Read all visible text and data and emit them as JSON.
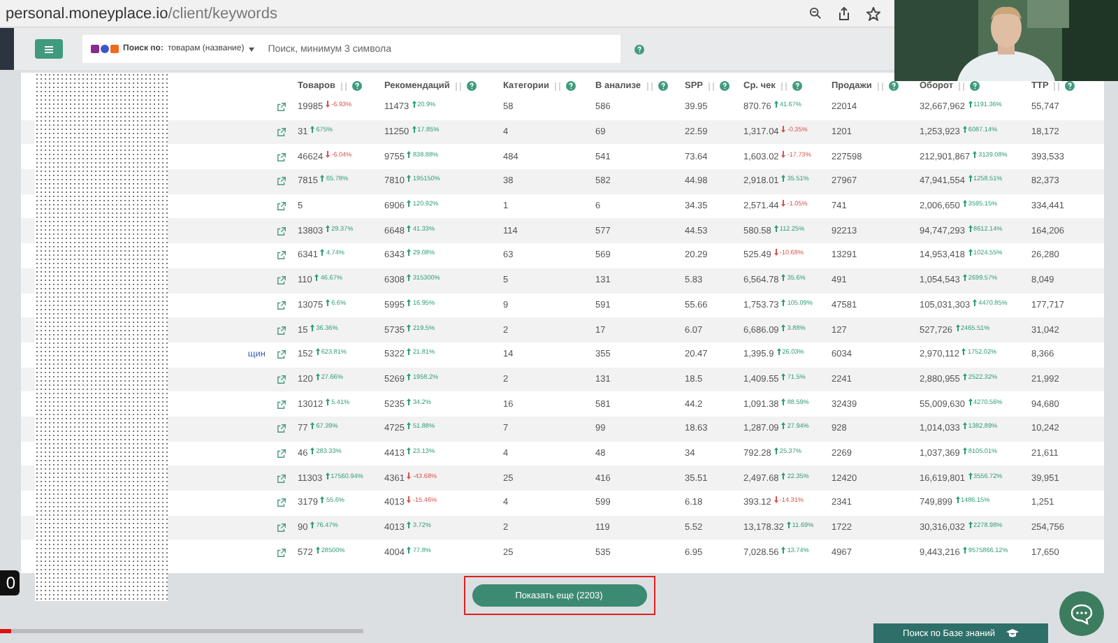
{
  "browser": {
    "url_host": "personal.moneyplace.io",
    "url_path": "/client/keywords"
  },
  "toolbar": {
    "search_by_label": "Поиск по:",
    "search_by_value": "товарам (название)",
    "search_placeholder": "Поиск, минимум 3 символа"
  },
  "table": {
    "columns": [
      "Товаров",
      "Рекомендаций",
      "Категории",
      "В анализе",
      "SPP",
      "Ср. чек",
      "Продажи",
      "Оборот",
      "TTP"
    ],
    "rows": [
      {
        "cells": [
          {
            "value": "19985",
            "change": "-6.93%",
            "rising": false
          },
          {
            "value": "11473",
            "change": "20.9%",
            "rising": true
          },
          {
            "value": "58"
          },
          {
            "value": "586"
          },
          {
            "value": "39.95"
          },
          {
            "value": "870.76",
            "change": "41.67%",
            "rising": true
          },
          {
            "value": "22014"
          },
          {
            "value": "32,667,962",
            "change": "1191.36%",
            "rising": true
          },
          {
            "value": "55,747"
          }
        ]
      },
      {
        "cells": [
          {
            "value": "31",
            "change": "675%",
            "rising": true
          },
          {
            "value": "11250",
            "change": "17.85%",
            "rising": true
          },
          {
            "value": "4"
          },
          {
            "value": "69"
          },
          {
            "value": "22.59"
          },
          {
            "value": "1,317.04",
            "change": "-0.35%",
            "rising": false
          },
          {
            "value": "1201"
          },
          {
            "value": "1,253,923",
            "change": "6087.14%",
            "rising": true
          },
          {
            "value": "18,172"
          }
        ]
      },
      {
        "cells": [
          {
            "value": "46624",
            "change": "-6.04%",
            "rising": false
          },
          {
            "value": "9755",
            "change": "838.88%",
            "rising": true
          },
          {
            "value": "484"
          },
          {
            "value": "541"
          },
          {
            "value": "73.64"
          },
          {
            "value": "1,603.02",
            "change": "-17.73%",
            "rising": false
          },
          {
            "value": "227598"
          },
          {
            "value": "212,901,867",
            "change": "3139.08%",
            "rising": true
          },
          {
            "value": "393,533"
          }
        ]
      },
      {
        "cells": [
          {
            "value": "7815",
            "change": "65.78%",
            "rising": true
          },
          {
            "value": "7810",
            "change": "195150%",
            "rising": true
          },
          {
            "value": "38"
          },
          {
            "value": "582"
          },
          {
            "value": "44.98"
          },
          {
            "value": "2,918.01",
            "change": "35.51%",
            "rising": true
          },
          {
            "value": "27967"
          },
          {
            "value": "47,941,554",
            "change": "1258.51%",
            "rising": true
          },
          {
            "value": "82,373"
          }
        ]
      },
      {
        "cells": [
          {
            "value": "5"
          },
          {
            "value": "6906",
            "change": "120.92%",
            "rising": true
          },
          {
            "value": "1"
          },
          {
            "value": "6"
          },
          {
            "value": "34.35"
          },
          {
            "value": "2,571.44",
            "change": "-1.05%",
            "rising": false
          },
          {
            "value": "741"
          },
          {
            "value": "2,006,650",
            "change": "3595.15%",
            "rising": true
          },
          {
            "value": "334,441"
          }
        ]
      },
      {
        "cells": [
          {
            "value": "13803",
            "change": "29.37%",
            "rising": true
          },
          {
            "value": "6648",
            "change": "41.33%",
            "rising": true
          },
          {
            "value": "114"
          },
          {
            "value": "577"
          },
          {
            "value": "44.53"
          },
          {
            "value": "580.58",
            "change": "112.25%",
            "rising": true
          },
          {
            "value": "92213"
          },
          {
            "value": "94,747,293",
            "change": "8612.14%",
            "rising": true
          },
          {
            "value": "164,206"
          }
        ]
      },
      {
        "cells": [
          {
            "value": "6341",
            "change": "4.74%",
            "rising": true
          },
          {
            "value": "6343",
            "change": "29.08%",
            "rising": true
          },
          {
            "value": "63"
          },
          {
            "value": "569"
          },
          {
            "value": "20.29"
          },
          {
            "value": "525.49",
            "change": "-10.68%",
            "rising": false
          },
          {
            "value": "13291"
          },
          {
            "value": "14,953,418",
            "change": "1024.55%",
            "rising": true
          },
          {
            "value": "26,280"
          }
        ]
      },
      {
        "cells": [
          {
            "value": "110",
            "change": "46.67%",
            "rising": true
          },
          {
            "value": "6308",
            "change": "315300%",
            "rising": true
          },
          {
            "value": "5"
          },
          {
            "value": "131"
          },
          {
            "value": "5.83"
          },
          {
            "value": "6,564.78",
            "change": "35.6%",
            "rising": true
          },
          {
            "value": "491"
          },
          {
            "value": "1,054,543",
            "change": "2699.57%",
            "rising": true
          },
          {
            "value": "8,049"
          }
        ]
      },
      {
        "cells": [
          {
            "value": "13075",
            "change": "6.6%",
            "rising": true
          },
          {
            "value": "5995",
            "change": "16.95%",
            "rising": true
          },
          {
            "value": "9"
          },
          {
            "value": "591"
          },
          {
            "value": "55.66"
          },
          {
            "value": "1,753.73",
            "change": "105.09%",
            "rising": true
          },
          {
            "value": "47581"
          },
          {
            "value": "105,031,303",
            "change": "4470.85%",
            "rising": true
          },
          {
            "value": "177,717"
          }
        ]
      },
      {
        "cells": [
          {
            "value": "15",
            "change": "36.36%",
            "rising": true
          },
          {
            "value": "5735",
            "change": "219.5%",
            "rising": true
          },
          {
            "value": "2"
          },
          {
            "value": "17"
          },
          {
            "value": "6.07"
          },
          {
            "value": "6,686.09",
            "change": "3.88%",
            "rising": true
          },
          {
            "value": "127"
          },
          {
            "value": "527,726",
            "change": "2465.51%",
            "rising": true
          },
          {
            "value": "31,042"
          }
        ]
      },
      {
        "name": "щин",
        "cells": [
          {
            "value": "152",
            "change": "623.81%",
            "rising": true
          },
          {
            "value": "5322",
            "change": "21.81%",
            "rising": true
          },
          {
            "value": "14"
          },
          {
            "value": "355"
          },
          {
            "value": "20.47"
          },
          {
            "value": "1,395.9",
            "change": "26.03%",
            "rising": true
          },
          {
            "value": "6034"
          },
          {
            "value": "2,970,112",
            "change": "1752.02%",
            "rising": true
          },
          {
            "value": "8,366"
          }
        ]
      },
      {
        "cells": [
          {
            "value": "120",
            "change": "27.66%",
            "rising": true
          },
          {
            "value": "5269",
            "change": "1958.2%",
            "rising": true
          },
          {
            "value": "2"
          },
          {
            "value": "131"
          },
          {
            "value": "18.5"
          },
          {
            "value": "1,409.55",
            "change": "71.5%",
            "rising": true
          },
          {
            "value": "2241"
          },
          {
            "value": "2,880,955",
            "change": "2522.32%",
            "rising": true
          },
          {
            "value": "21,992"
          }
        ]
      },
      {
        "cells": [
          {
            "value": "13012",
            "change": "5.41%",
            "rising": true
          },
          {
            "value": "5235",
            "change": "34.2%",
            "rising": true
          },
          {
            "value": "16"
          },
          {
            "value": "581"
          },
          {
            "value": "44.2"
          },
          {
            "value": "1,091.38",
            "change": "88.59%",
            "rising": true
          },
          {
            "value": "32439"
          },
          {
            "value": "55,009,630",
            "change": "4270.56%",
            "rising": true
          },
          {
            "value": "94,680"
          }
        ]
      },
      {
        "cells": [
          {
            "value": "77",
            "change": "67.39%",
            "rising": true
          },
          {
            "value": "4725",
            "change": "51.88%",
            "rising": true
          },
          {
            "value": "7"
          },
          {
            "value": "99"
          },
          {
            "value": "18.63"
          },
          {
            "value": "1,287.09",
            "change": "27.94%",
            "rising": true
          },
          {
            "value": "928"
          },
          {
            "value": "1,014,033",
            "change": "1382.89%",
            "rising": true
          },
          {
            "value": "10,242"
          }
        ]
      },
      {
        "cells": [
          {
            "value": "46",
            "change": "283.33%",
            "rising": true
          },
          {
            "value": "4413",
            "change": "23.13%",
            "rising": true
          },
          {
            "value": "4"
          },
          {
            "value": "48"
          },
          {
            "value": "34"
          },
          {
            "value": "792.28",
            "change": "25.37%",
            "rising": true
          },
          {
            "value": "2269"
          },
          {
            "value": "1,037,369",
            "change": "8105.01%",
            "rising": true
          },
          {
            "value": "21,611"
          }
        ]
      },
      {
        "cells": [
          {
            "value": "11303",
            "change": "17560.94%",
            "rising": true
          },
          {
            "value": "4361",
            "change": "-43.68%",
            "rising": false
          },
          {
            "value": "25"
          },
          {
            "value": "416"
          },
          {
            "value": "35.51"
          },
          {
            "value": "2,497.68",
            "change": "22.35%",
            "rising": true
          },
          {
            "value": "12420"
          },
          {
            "value": "16,619,801",
            "change": "3556.72%",
            "rising": true
          },
          {
            "value": "39,951"
          }
        ]
      },
      {
        "cells": [
          {
            "value": "3179",
            "change": "55.6%",
            "rising": true
          },
          {
            "value": "4013",
            "change": "-15.46%",
            "rising": false
          },
          {
            "value": "4"
          },
          {
            "value": "599"
          },
          {
            "value": "6.18"
          },
          {
            "value": "393.12",
            "change": "-14.31%",
            "rising": false
          },
          {
            "value": "2341"
          },
          {
            "value": "749,899",
            "change": "1486.15%",
            "rising": true
          },
          {
            "value": "1,251"
          }
        ]
      },
      {
        "cells": [
          {
            "value": "90",
            "change": "76.47%",
            "rising": true
          },
          {
            "value": "4013",
            "change": "3.72%",
            "rising": true
          },
          {
            "value": "2"
          },
          {
            "value": "119"
          },
          {
            "value": "5.52"
          },
          {
            "value": "13,178.32",
            "change": "11.69%",
            "rising": true
          },
          {
            "value": "1722"
          },
          {
            "value": "30,316,032",
            "change": "2278.98%",
            "rising": true
          },
          {
            "value": "254,756"
          }
        ]
      },
      {
        "cells": [
          {
            "value": "572",
            "change": "28500%",
            "rising": true
          },
          {
            "value": "4004",
            "change": "77.8%",
            "rising": true
          },
          {
            "value": "25"
          },
          {
            "value": "535"
          },
          {
            "value": "6.95"
          },
          {
            "value": "7,028.56",
            "change": "13.74%",
            "rising": true
          },
          {
            "value": "4967"
          },
          {
            "value": "9,443,216",
            "change": "9575866.12%",
            "rising": true
          },
          {
            "value": "17,650"
          }
        ]
      }
    ]
  },
  "show_more": {
    "label": "Показать еще (2203)"
  },
  "knowledge_base": {
    "label": "Поиск по Базе знаний"
  },
  "video": {
    "time": "0",
    "level": 0.03
  }
}
